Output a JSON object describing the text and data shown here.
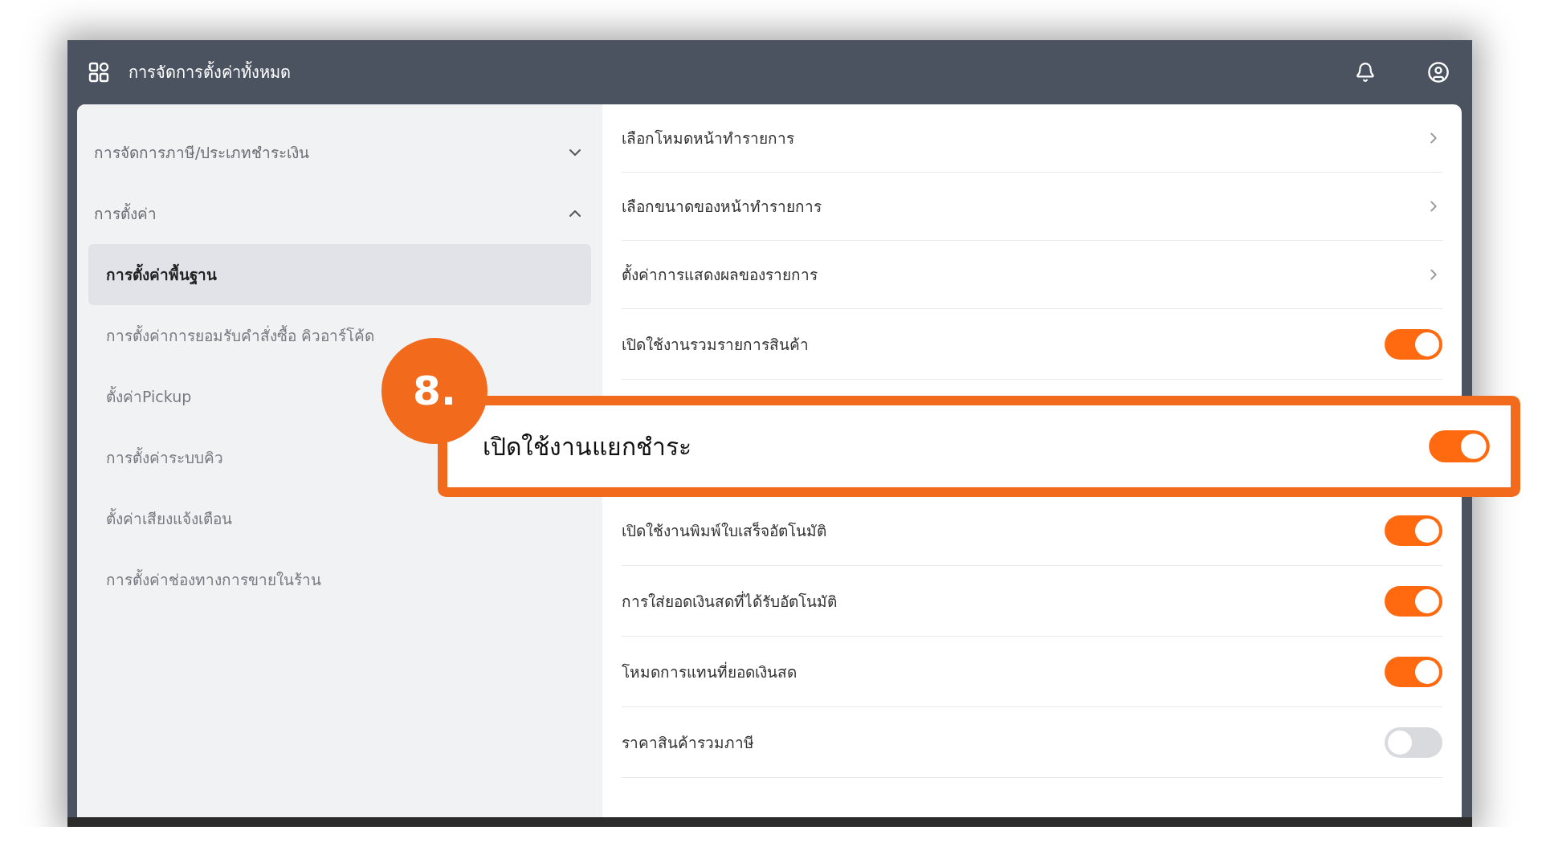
{
  "header": {
    "title": "การจัดการตั้งค่าทั้งหมด"
  },
  "sidebar": {
    "groups": [
      {
        "label": "การจัดการภาษี/ประเภทชำระเงิน",
        "expanded": false
      },
      {
        "label": "การตั้งค่า",
        "expanded": true,
        "items": [
          {
            "label": "การตั้งค่าพื้นฐาน",
            "selected": true
          },
          {
            "label": "การตั้งค่าการยอมรับคำสั่งซื้อ คิวอาร์โค้ด",
            "selected": false
          },
          {
            "label": "ตั้งค่าPickup",
            "selected": false
          },
          {
            "label": "การตั้งค่าระบบคิว",
            "selected": false
          },
          {
            "label": "ตั้งค่าเสียงแจ้งเตือน",
            "selected": false
          },
          {
            "label": "การตั้งค่าช่องทางการขายในร้าน",
            "selected": false
          }
        ]
      }
    ]
  },
  "settings": {
    "rows_above": [
      {
        "label": "เลือกโหมดหน้าทำรายการ",
        "kind": "link"
      },
      {
        "label": "เลือกขนาดของหน้าทำรายการ",
        "kind": "link"
      },
      {
        "label": "ตั้งค่าการแสดงผลของรายการ",
        "kind": "link"
      },
      {
        "label": "เปิดใช้งานรวมรายการสินค้า",
        "kind": "toggle",
        "on": true
      }
    ],
    "rows_below": [
      {
        "label": "เปิดใช้งานพิมพ์ใบเสร็จอัตโนมัติ",
        "kind": "toggle",
        "on": true
      },
      {
        "label": "การใส่ยอดเงินสดที่ได้รับอัตโนมัติ",
        "kind": "toggle",
        "on": true
      },
      {
        "label": "โหมดการแทนที่ยอดเงินสด",
        "kind": "toggle",
        "on": true
      },
      {
        "label": "ราคาสินค้ารวมภาษี",
        "kind": "toggle",
        "on": false
      }
    ]
  },
  "callout": {
    "step": "8.",
    "label": "เปิดใช้งานแยกชำระ",
    "on": true
  }
}
